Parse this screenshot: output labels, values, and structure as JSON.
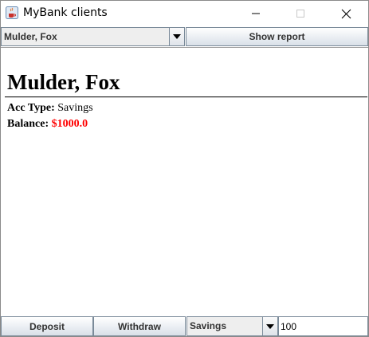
{
  "window": {
    "title": "MyBank clients",
    "icon": "java-coffee-cup-icon"
  },
  "toolbar": {
    "client_select_value": "Mulder, Fox",
    "show_report_label": "Show report"
  },
  "report": {
    "client_name": "Mulder, Fox",
    "acc_type_label": "Acc Type:",
    "acc_type_value": "Savings",
    "balance_label": "Balance:",
    "balance_value": "$1000.0",
    "balance_color": "#ff0000"
  },
  "actions": {
    "deposit_label": "Deposit",
    "withdraw_label": "Withdraw",
    "account_select_value": "Savings",
    "amount_value": "100"
  }
}
